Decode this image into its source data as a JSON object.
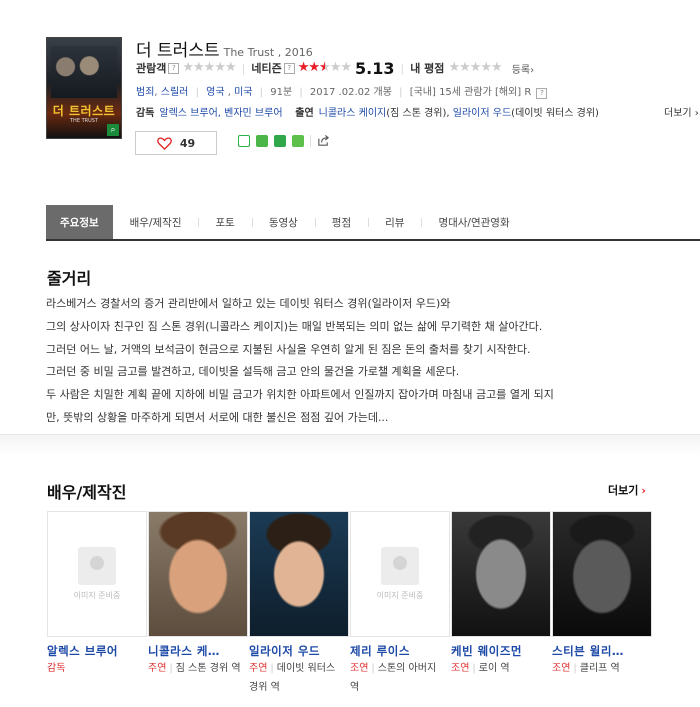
{
  "movie": {
    "title": "더 트러스트",
    "original": "The Trust , 2016",
    "poster_title": "더 트러스트",
    "poster_sub": "THE TRUST"
  },
  "ratings": {
    "audience_label": "관람객",
    "netizen_label": "네티즌",
    "netizen_score": "5.13",
    "netizen_fraction": 0.513,
    "my_label": "내 평점",
    "register": "등록›"
  },
  "info": {
    "genre1": "범죄",
    "genre2": "스릴러",
    "country1": "영국",
    "country2": "미국",
    "runtime": "91분",
    "release": "2017 .02.02 개봉",
    "grade": "[국내] 15세 관람가 [해외] R"
  },
  "credits": {
    "director_label": "감독",
    "directors": "알렉스 브루어, 벤자민 브루어",
    "cast_label": "출연",
    "actor1": "니콜라스 케이지",
    "actor1_role": "(짐 스톤 경위),",
    "actor2": "일라이저 우드",
    "actor2_role": "(데이빗 워터스 경위)",
    "more": "더보기 ›"
  },
  "like": {
    "count": "49"
  },
  "tabs": [
    {
      "label": "주요정보"
    },
    {
      "label": "배우/제작진"
    },
    {
      "label": "포토"
    },
    {
      "label": "동영상"
    },
    {
      "label": "평점"
    },
    {
      "label": "리뷰"
    },
    {
      "label": "명대사/연관영화"
    }
  ],
  "synopsis": {
    "heading": "줄거리",
    "lines": [
      "라스베거스 경찰서의 증거 관리반에서 일하고 있는 데이빗 워터스 경위(일라이저 우드)와",
      "  그의 상사이자 친구인 짐 스톤 경위(니콜라스 케이지)는 매일 반복되는 의미 없는 삶에 무기력한 채 살아간다.",
      "  그러던 어느 날, 거액의 보석금이 현금으로 지불된 사실을 우연히 알게 된 짐은 돈의 출처를 찾기 시작한다.",
      "  그러던 중 비밀 금고를 발견하고, 데이빗을 설득해 금고 안의 물건을 가로챌 계획을 세운다.",
      "  두 사람은 치밀한 계획 끝에 지하에 비밀 금고가 위치한 아파트에서 인질까지 잡아가며 마침내 금고를 열게 되지",
      "만, 뜻밖의 상황을 마주하게 되면서 서로에 대한 불신은 점점 깊어 가는데..."
    ]
  },
  "cast": {
    "heading": "배우/제작진",
    "more": "더보기",
    "no_image": "이미지 준비중",
    "members": [
      {
        "name": "알렉스 브루어",
        "role_type": "감독",
        "role_desc": ""
      },
      {
        "name": "니콜라스 케…",
        "role_type": "주연",
        "role_desc": "짐 스톤 경위 역"
      },
      {
        "name": "일라이저 우드",
        "role_type": "주연",
        "role_desc": "데이빗 워터스 경위 역"
      },
      {
        "name": "제리 루이스",
        "role_type": "조연",
        "role_desc": "스톤의 아버지 역"
      },
      {
        "name": "케빈 웨이즈먼",
        "role_type": "조연",
        "role_desc": "로이 역"
      },
      {
        "name": "스티븐 윌리…",
        "role_type": "조연",
        "role_desc": "클리프 역"
      }
    ]
  },
  "colors": {
    "accent_red": "#ee1c25",
    "link_blue": "#1d49a7",
    "tab_active": "#6b6b6b"
  }
}
